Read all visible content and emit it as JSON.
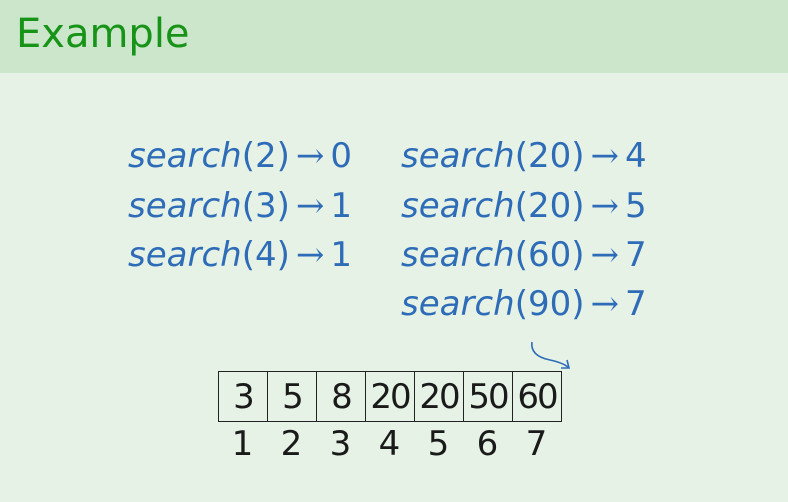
{
  "title": "Example",
  "arrow_symbol": "→",
  "searches_left": [
    {
      "fn": "search",
      "arg": "(2)",
      "result": "0"
    },
    {
      "fn": "search",
      "arg": "(3)",
      "result": "1"
    },
    {
      "fn": "search",
      "arg": "(4)",
      "result": "1"
    }
  ],
  "searches_right": [
    {
      "fn": "search",
      "arg": "(20)",
      "result": "4"
    },
    {
      "fn": "search",
      "arg": "(20)",
      "result": "5"
    },
    {
      "fn": "search",
      "arg": "(60)",
      "result": "7"
    },
    {
      "fn": "search",
      "arg": "(90)",
      "result": "7"
    }
  ],
  "array": {
    "values": [
      "3",
      "5",
      "8",
      "20",
      "20",
      "50",
      "60"
    ],
    "indices": [
      "1",
      "2",
      "3",
      "4",
      "5",
      "6",
      "7"
    ]
  },
  "colors": {
    "header_bg": "#cce6cc",
    "body_bg": "#e5f2e5",
    "title": "#179417",
    "search_text": "#2e6cb8"
  }
}
